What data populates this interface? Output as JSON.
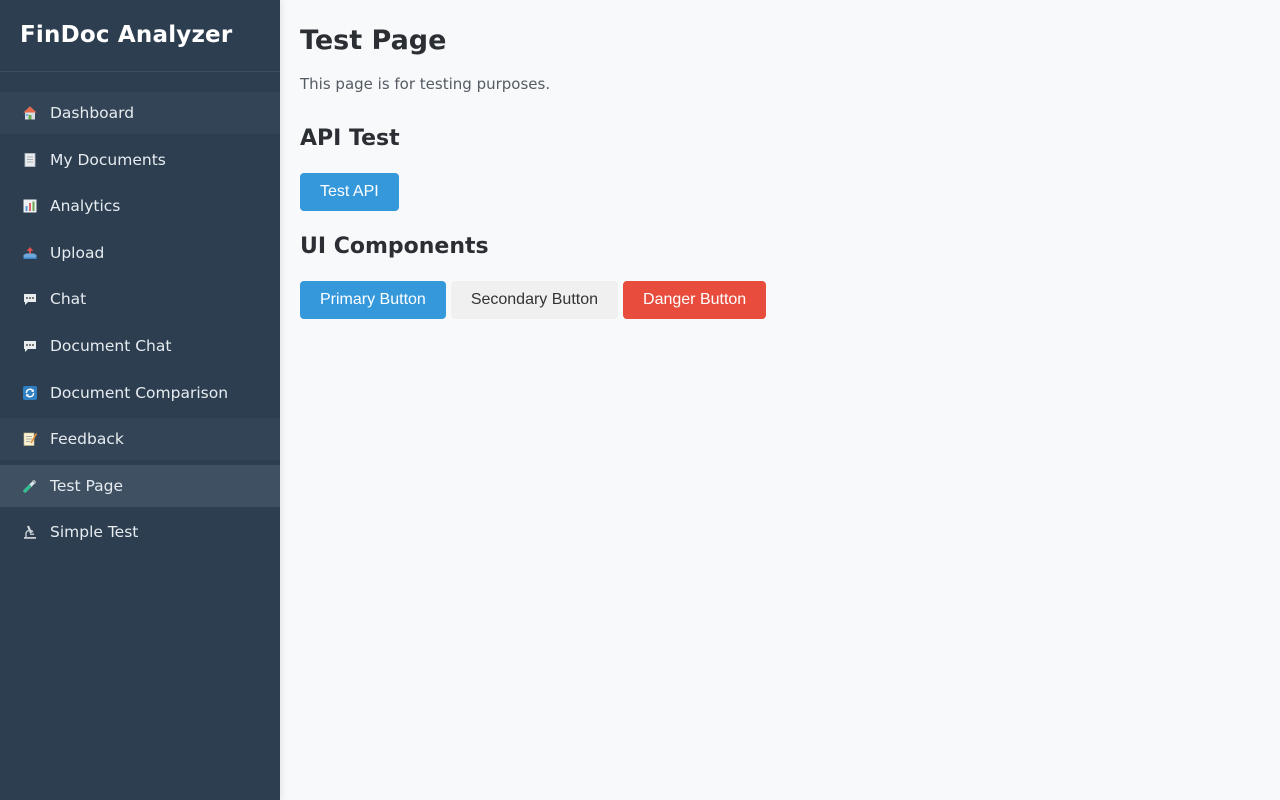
{
  "sidebar": {
    "brand": "FinDoc Analyzer",
    "items": [
      {
        "label": "Dashboard",
        "icon": "house-icon"
      },
      {
        "label": "My Documents",
        "icon": "page-icon"
      },
      {
        "label": "Analytics",
        "icon": "bar-chart-icon"
      },
      {
        "label": "Upload",
        "icon": "outbox-tray-icon"
      },
      {
        "label": "Chat",
        "icon": "speech-bubble-icon"
      },
      {
        "label": "Document Chat",
        "icon": "speech-bubble-icon"
      },
      {
        "label": "Document Comparison",
        "icon": "arrows-cycle-icon"
      },
      {
        "label": "Feedback",
        "icon": "memo-icon"
      },
      {
        "label": "Test Page",
        "icon": "test-tube-icon"
      },
      {
        "label": "Simple Test",
        "icon": "microscope-icon"
      }
    ],
    "active_item": "Test Page"
  },
  "main": {
    "title": "Test Page",
    "description": "This page is for testing purposes.",
    "api_section": {
      "heading": "API Test",
      "button_label": "Test API"
    },
    "ui_section": {
      "heading": "UI Components",
      "primary_label": "Primary Button",
      "secondary_label": "Secondary Button",
      "danger_label": "Danger Button"
    }
  },
  "colors": {
    "sidebar_bg": "#2c3e50",
    "active_item_bg": "#3e5062",
    "primary": "#3498db",
    "secondary": "#f0f0f0",
    "danger": "#e74c3c",
    "page_bg": "#f7f9fb"
  }
}
